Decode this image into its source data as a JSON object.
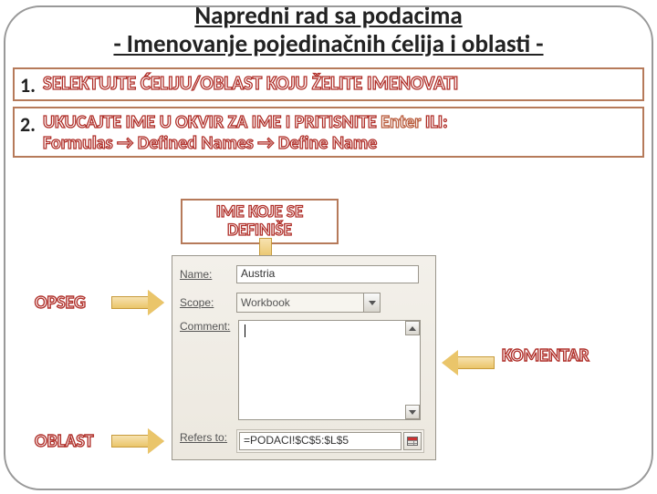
{
  "title": {
    "line1": "Napredni rad sa podacima",
    "line2": "- Imenovanje pojedinačnih ćelija i oblasti -"
  },
  "steps": {
    "s1": {
      "num": "1.",
      "text": "SELEKTUJTE ĆELIJU/OBLAST KOJU ŽELITE IMENOVATI"
    },
    "s2": {
      "num": "2.",
      "line1a": "UKUCAJTE IME U OKVIR ZA IME I PRITISNITE ",
      "enter": "Enter",
      "line1b": " ILI:",
      "line2": "Formulas → Defined Names → Define Name"
    }
  },
  "callouts": {
    "ime": "IME KOJE SE DEFINIŠE",
    "opseg": "OPSEG",
    "oblast": "OBLAST",
    "komentar": "KOMENTAR"
  },
  "dialog": {
    "name_label": "Name:",
    "name_value": "Austria",
    "scope_label": "Scope:",
    "scope_value": "Workbook",
    "comment_label": "Comment:",
    "refers_label": "Refers to:",
    "refers_value": "=PODACI!$C$5:$L$5"
  }
}
